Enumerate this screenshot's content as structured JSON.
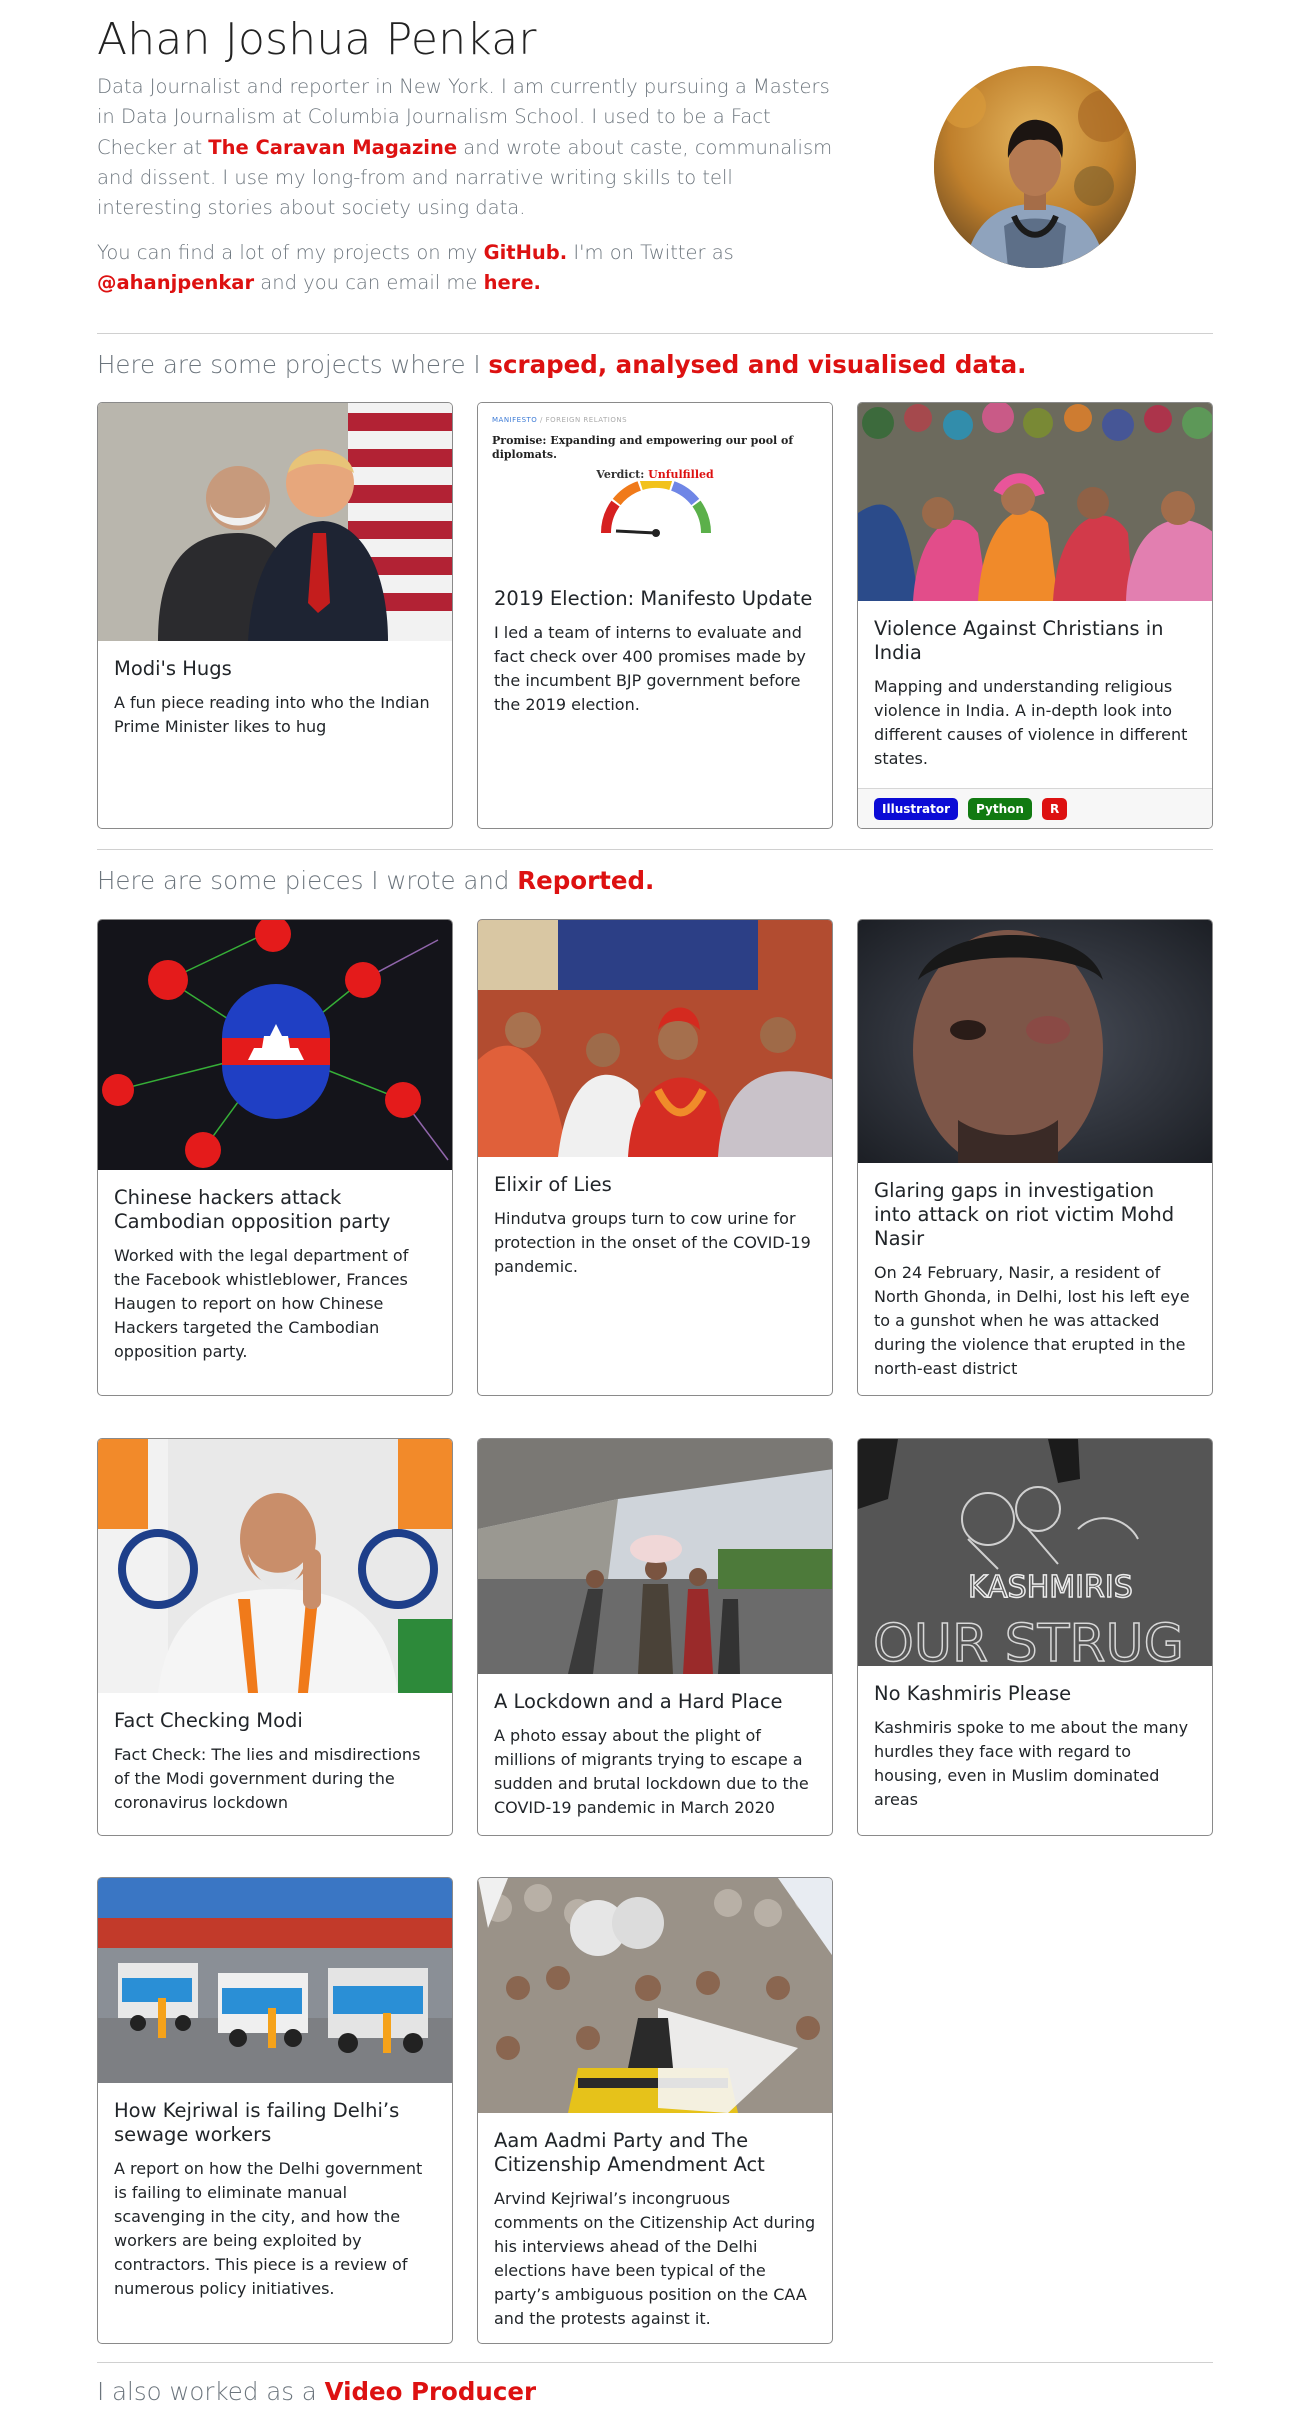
{
  "header": {
    "name": "Ahan Joshua Penkar",
    "bio_part1": "Data Journalist and reporter in New York. I am currently pursuing a Masters in Data Journalism at Columbia Journalism School. I used to be a Fact Checker at ",
    "bio_link": "The Caravan Magazine",
    "bio_part2": " and wrote about caste, communalism and dissent. I use my long-from and narrative writing skills to tell interesting stories about society using data.",
    "contact_part1": "You can find a lot of my projects on my ",
    "contact_github": "GitHub.",
    "contact_part2": " I'm on Twitter as ",
    "contact_twitter": "@ahanjpenkar",
    "contact_part3": " and you can email me ",
    "contact_email": "here."
  },
  "sections": {
    "projects_prefix": "Here are some projects where I ",
    "projects_highlight": "scraped, analysed and visualised data.",
    "reported_prefix": "Here are some pieces I wrote and ",
    "reported_highlight": "Reported.",
    "video_prefix": "I also worked as a ",
    "video_highlight": "Video Producer"
  },
  "manifesto_thumb": {
    "crumb1": "MANIFESTO",
    "crumb_sep": "/",
    "crumb2": "FOREIGN RELATIONS",
    "promise": "Promise: Expanding and empowering our pool of diplomats.",
    "verdict_label": "Verdict: ",
    "verdict_value": "Unfulfilled"
  },
  "projects": [
    {
      "title": "Modi's Hugs",
      "text": "A fun piece reading into who the Indian Prime Minister likes to hug"
    },
    {
      "title": "2019 Election: Manifesto Update",
      "text": "I led a team of interns to evaluate and fact check over 400 promises made by the incumbent BJP government before the 2019 election."
    },
    {
      "title": "Violence Against Christians in India",
      "text": "Mapping and understanding religious violence in India. A in-depth look into different causes of violence in different states.",
      "tags": [
        "Illustrator",
        "Python",
        "R"
      ]
    }
  ],
  "tag_colors": {
    "Illustrator": "#0b0bd6",
    "Python": "#117a11",
    "R": "#d11"
  },
  "pieces": [
    {
      "title": "Chinese hackers attack Cambodian opposition party",
      "text": "Worked with the legal department of the Facebook whistleblower, Frances Haugen to report on how Chinese Hackers targeted the Cambodian opposition party."
    },
    {
      "title": "Elixir of Lies",
      "text": "Hindutva groups turn to cow urine for protection in the onset of the COVID-19 pandemic."
    },
    {
      "title": "Glaring gaps in investigation into attack on riot victim Mohd Nasir",
      "text": "On 24 February, Nasir, a resident of North Ghonda, in Delhi, lost his left eye to a gunshot when he was attacked during the violence that erupted in the north-east district"
    },
    {
      "title": "Fact Checking Modi",
      "text": "Fact Check: The lies and misdirections of the Modi government during the coronavirus lockdown"
    },
    {
      "title": "A Lockdown and a Hard Place",
      "text": "A photo essay about the plight of millions of migrants trying to escape a sudden and brutal lockdown due to the COVID-19 pandemic in March 2020"
    },
    {
      "title": "No Kashmiris Please",
      "text": "Kashmiris spoke to me about the many hurdles they face with regard to housing, even in Muslim dominated areas"
    },
    {
      "title": "How Kejriwal is failing Delhi’s sewage workers",
      "text": "A report on how the Delhi government is failing to eliminate manual scavenging in the city, and how the workers are being exploited by contractors. This piece is a review of numerous policy initiatives."
    },
    {
      "title": "Aam Aadmi Party and The Citizenship Amendment Act",
      "text": "Arvind Kejriwal’s incongruous comments on the Citizenship Act during his interviews ahead of the Delhi elections have been typical of the party’s ambiguous position on the CAA and the protests against it."
    }
  ],
  "kashmir_thumb": {
    "word1": "KASHMIRIS",
    "word2": "OUR STRUG"
  }
}
